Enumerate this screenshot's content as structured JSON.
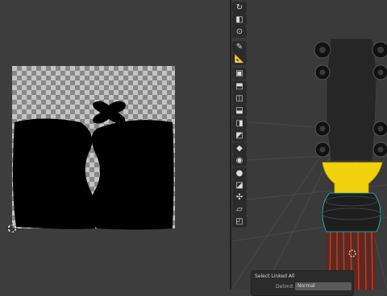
{
  "uv_editor": {
    "checker_colors": {
      "light": "#c4c4c4",
      "dark": "#888888"
    },
    "island_color": "#000000"
  },
  "viewport": {
    "model_colors": {
      "mesh_dark": "#1e1e1e",
      "selected_yellow": "#f2d20c",
      "edges_red": "#c53a23",
      "wire_teal": "#1ec7b6"
    }
  },
  "toolbar": {
    "tools": [
      {
        "name": "rotate-view-icon",
        "glyph": "↻"
      },
      {
        "name": "object-icon",
        "glyph": "◧"
      },
      {
        "name": "cursor-tool-icon",
        "glyph": "⊙"
      },
      {
        "name": "annotate-icon",
        "glyph": "✎"
      },
      {
        "name": "measure-icon",
        "glyph": "📐"
      },
      {
        "name": "add-cube-icon",
        "glyph": "▣"
      },
      {
        "name": "extrude-icon",
        "glyph": "⬒"
      },
      {
        "name": "inset-icon",
        "glyph": "◫"
      },
      {
        "name": "bevel-icon",
        "glyph": "⬓"
      },
      {
        "name": "loop-cut-icon",
        "glyph": "◨"
      },
      {
        "name": "knife-icon",
        "glyph": "◩"
      },
      {
        "name": "poly-build-icon",
        "glyph": "◆"
      },
      {
        "name": "spin-icon",
        "glyph": "◉"
      },
      {
        "name": "smooth-icon",
        "glyph": "●"
      },
      {
        "name": "edge-slide-icon",
        "glyph": "◪"
      },
      {
        "name": "shrink-fatten-icon",
        "glyph": "✣"
      },
      {
        "name": "shear-icon",
        "glyph": "▱"
      },
      {
        "name": "rip-region-icon",
        "glyph": "◰"
      }
    ]
  },
  "operator_panel": {
    "title": "Select Linked All",
    "delimit_label": "Delimit",
    "delimit_value": "Normal"
  }
}
